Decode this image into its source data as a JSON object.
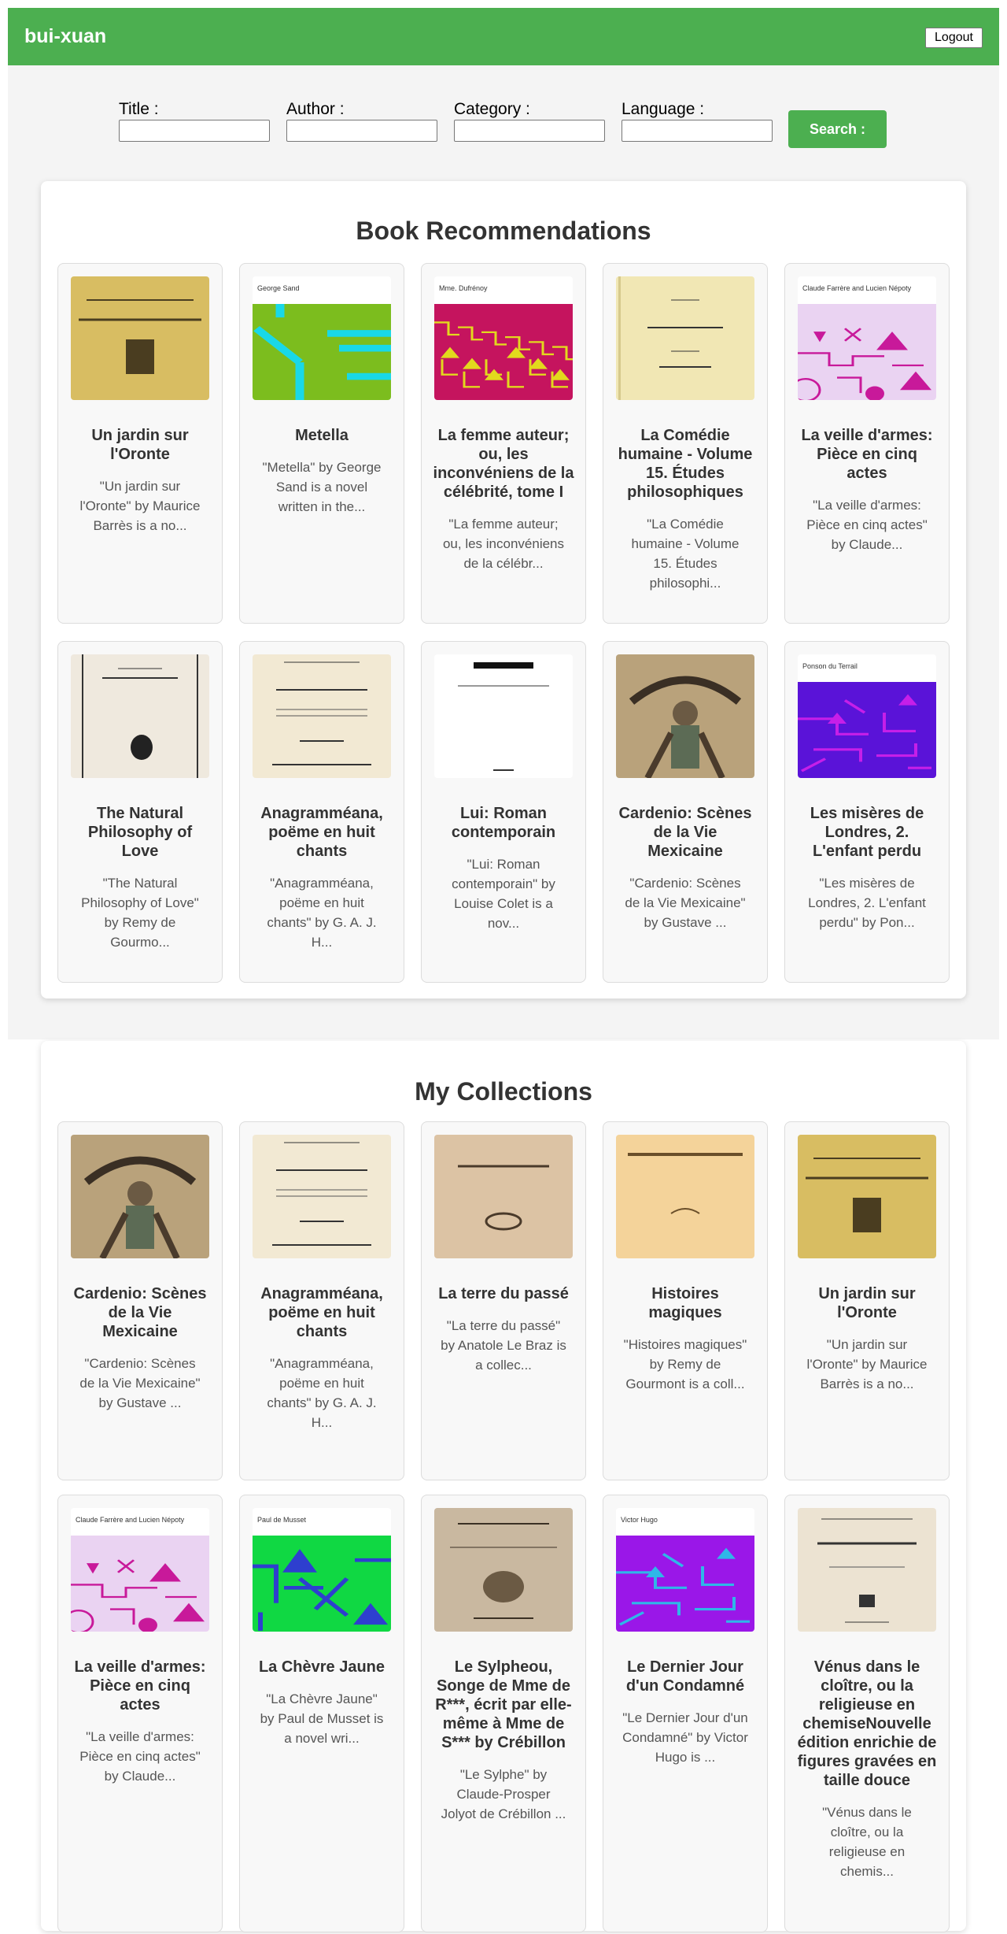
{
  "header": {
    "brand": "bui-xuan",
    "logout_label": "Logout"
  },
  "search": {
    "title_label": "Title :",
    "author_label": "Author :",
    "category_label": "Category :",
    "language_label": "Language :",
    "title_value": "",
    "author_value": "",
    "category_value": "",
    "language_value": "",
    "button_label": "Search :"
  },
  "colors": {
    "accent": "#4caf50"
  },
  "recommendations": {
    "heading": "Book Recommendations",
    "books": [
      {
        "title": "Un jardin sur l'Oronte",
        "description": "\"Un jardin sur l'Oronte\" by Maurice Barrès is a no...",
        "cover": "scan-jardin"
      },
      {
        "title": "Metella",
        "description": "\"Metella\" by George Sand is a novel written in the...",
        "cover": "generated",
        "cover_author": "George Sand"
      },
      {
        "title": "La femme auteur; ou, les inconvéniens de la célébrité, tome I",
        "description": "\"La femme auteur; ou, les inconvéniens de la célébr...",
        "cover": "generated",
        "cover_author": "Mme. Dufrénoy"
      },
      {
        "title": "La Comédie humaine - Volume 15. Études philosophiques",
        "description": "\"La Comédie humaine - Volume 15. Études philosophi...",
        "cover": "scan-balzac"
      },
      {
        "title": "La veille d'armes: Pièce en cinq actes",
        "description": "\"La veille d'armes: Pièce en cinq actes\" by Claude...",
        "cover": "generated",
        "cover_author": "Claude Farrère and Lucien Népoty"
      },
      {
        "title": "The Natural Philosophy of Love",
        "description": "\"The Natural Philosophy of Love\" by Remy de Gourmo...",
        "cover": "scan-gourmont"
      },
      {
        "title": "Anagramméana, poëme en huit chants",
        "description": "\"Anagramméana, poëme en huit chants\" by G. A. J. H...",
        "cover": "scan-anagram"
      },
      {
        "title": "Lui: Roman contemporain",
        "description": "\"Lui: Roman contemporain\" by Louise Colet is a nov...",
        "cover": "scan-lui"
      },
      {
        "title": "Cardenio: Scènes de la Vie Mexicaine",
        "description": "\"Cardenio: Scènes de la Vie Mexicaine\" by Gustave ...",
        "cover": "scan-cardenio"
      },
      {
        "title": "Les misères de Londres, 2. L'enfant perdu",
        "description": "\"Les misères de Londres, 2. L'enfant perdu\" by Pon...",
        "cover": "generated",
        "cover_author": "Ponson du Terrail"
      }
    ]
  },
  "collections": {
    "heading": "My Collections",
    "books": [
      {
        "title": "Cardenio: Scènes de la Vie Mexicaine",
        "description": "\"Cardenio: Scènes de la Vie Mexicaine\" by Gustave ...",
        "cover": "scan-cardenio"
      },
      {
        "title": "Anagramméana, poëme en huit chants",
        "description": "\"Anagramméana, poëme en huit chants\" by G. A. J. H...",
        "cover": "scan-anagram"
      },
      {
        "title": "La terre du passé",
        "description": "\"La terre du passé\" by Anatole Le Braz is a collec...",
        "cover": "scan-terre"
      },
      {
        "title": "Histoires magiques",
        "description": "\"Histoires magiques\" by Remy de Gourmont is a coll...",
        "cover": "scan-histoires"
      },
      {
        "title": "Un jardin sur l'Oronte",
        "description": "\"Un jardin sur l'Oronte\" by Maurice Barrès is a no...",
        "cover": "scan-jardin"
      },
      {
        "title": "La veille d'armes: Pièce en cinq actes",
        "description": "\"La veille d'armes: Pièce en cinq actes\" by Claude...",
        "cover": "generated",
        "cover_author": "Claude Farrère and Lucien Népoty"
      },
      {
        "title": "La Chèvre Jaune",
        "description": "\"La Chèvre Jaune\" by Paul de Musset is a novel wri...",
        "cover": "generated",
        "cover_author": "Paul de Musset"
      },
      {
        "title": "Le Sylpheou, Songe de Mme de R***, écrit par elle-même à Mme de S*** by Crébillon",
        "description": "\"Le Sylphe\" by Claude-Prosper Jolyot de Crébillon ...",
        "cover": "scan-sylphe"
      },
      {
        "title": "Le Dernier Jour d'un Condamné",
        "description": "\"Le Dernier Jour d'un Condamné\" by Victor Hugo is ...",
        "cover": "generated",
        "cover_author": "Victor Hugo"
      },
      {
        "title": "Vénus dans le cloître, ou la religieuse en chemiseNouvelle édition enrichie de figures gravées en taille douce",
        "description": "\"Vénus dans le cloître, ou la religieuse en chemis...",
        "cover": "scan-venus"
      }
    ]
  }
}
